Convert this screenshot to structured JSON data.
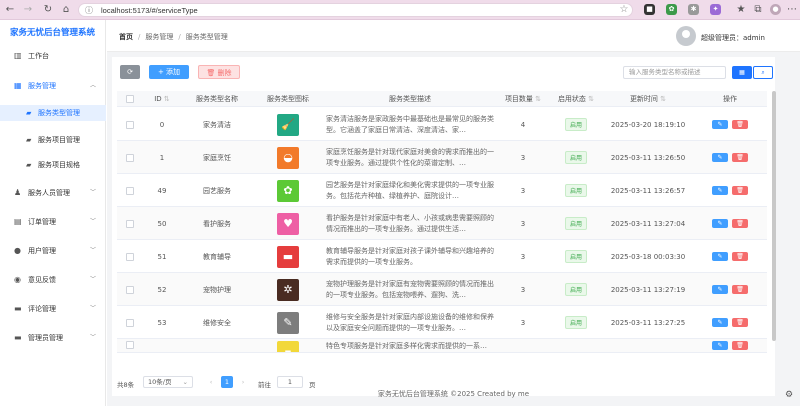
{
  "browser": {
    "url": "localhost:5173/#/serviceType"
  },
  "sidebar": {
    "title": "家务无忧后台管理系统",
    "items": [
      {
        "label": "工作台",
        "icon": "dashboard-icon"
      },
      {
        "label": "服务管理",
        "icon": "grid-icon",
        "open": true
      },
      {
        "label": "服务人员管理",
        "icon": "person-icon"
      },
      {
        "label": "订单管理",
        "icon": "order-icon"
      },
      {
        "label": "用户管理",
        "icon": "user-icon"
      },
      {
        "label": "意见反馈",
        "icon": "feedback-icon"
      },
      {
        "label": "评论管理",
        "icon": "comment-icon"
      },
      {
        "label": "管理员管理",
        "icon": "admin-icon"
      }
    ],
    "sub_items": [
      {
        "label": "服务类型管理",
        "active": true
      },
      {
        "label": "服务项目管理"
      },
      {
        "label": "服务项目规格"
      }
    ]
  },
  "header": {
    "breadcrumb": [
      "首页",
      "服务管理",
      "服务类型管理"
    ],
    "admin": "超级管理员：admin"
  },
  "toolbar": {
    "add": "+ 添加",
    "delete": "删除",
    "search_placeholder": "输入服务类型名称或描述"
  },
  "table": {
    "columns": [
      "ID",
      "服务类型名称",
      "服务类型图标",
      "服务类型描述",
      "项目数量",
      "启用状态",
      "更新时间",
      "操作"
    ],
    "rows": [
      {
        "id": "0",
        "name": "家务清洁",
        "icon_color": "#22a884",
        "icon": "broom-icon",
        "desc": "家务清洁服务是家政服务中最基础也是最常见的服务类型。它涵盖了家庭日常清洁、深度清洁、家…",
        "count": "4",
        "status": "启用",
        "time": "2025-03-20 18:19:10"
      },
      {
        "id": "1",
        "name": "家庭烹饪",
        "icon_color": "#f27a2a",
        "icon": "cooking-pot-icon",
        "desc": "家庭烹饪服务是针对现代家庭对美食的需求而推出的一项专业服务。通过提供个性化的菜谱定制、…",
        "count": "3",
        "status": "启用",
        "time": "2025-03-11 13:26:50"
      },
      {
        "id": "49",
        "name": "园艺服务",
        "icon_color": "#5cc936",
        "icon": "plant-icon",
        "desc": "园艺服务是针对家庭绿化和美化需求提供的一项专业服务。包括花卉种植、绿植养护、庭院设计…",
        "count": "3",
        "status": "启用",
        "time": "2025-03-11 13:26:57"
      },
      {
        "id": "50",
        "name": "看护服务",
        "icon_color": "#ee5fa4",
        "icon": "care-icon",
        "desc": "看护服务是针对家庭中有老人、小孩或病患需要照顾的情况而推出的一项专业服务。通过提供生活…",
        "count": "3",
        "status": "启用",
        "time": "2025-03-11 13:27:04"
      },
      {
        "id": "51",
        "name": "教育辅导",
        "icon_color": "#e53d3d",
        "icon": "book-icon",
        "desc": "教育辅导服务是针对家庭对孩子课外辅导和兴趣培养的需求而提供的一项专业服务。",
        "count": "3",
        "status": "启用",
        "time": "2025-03-18 00:03:30"
      },
      {
        "id": "52",
        "name": "宠物护理",
        "icon_color": "#4a2c22",
        "icon": "paw-icon",
        "desc": "宠物护理服务是针对家庭有宠物需要照顾的情况而推出的一项专业服务。包括宠物喂养、遛狗、洗…",
        "count": "3",
        "status": "启用",
        "time": "2025-03-11 13:27:19"
      },
      {
        "id": "53",
        "name": "维修安全",
        "icon_color": "#7d7d7d",
        "icon": "wrench-icon",
        "desc": "维修与安全服务是针对家庭内部设施设备的维修和保养以及家庭安全问题而提供的一项专业服务。…",
        "count": "3",
        "status": "启用",
        "time": "2025-03-11 13:27:25"
      },
      {
        "id": "",
        "name": "",
        "icon_color": "#f2d83a",
        "icon": "partial-icon",
        "desc": "特色专项服务是针对家庭多样化需求而提供的一系…",
        "count": "",
        "status": "",
        "time": ""
      }
    ]
  },
  "pager": {
    "total": "共8条",
    "size": "10条/页",
    "page": "1",
    "goto": "前往",
    "goto_value": "1",
    "unit": "页"
  },
  "footer": "家务无忧后台管理系统 ©2025 Created by me"
}
